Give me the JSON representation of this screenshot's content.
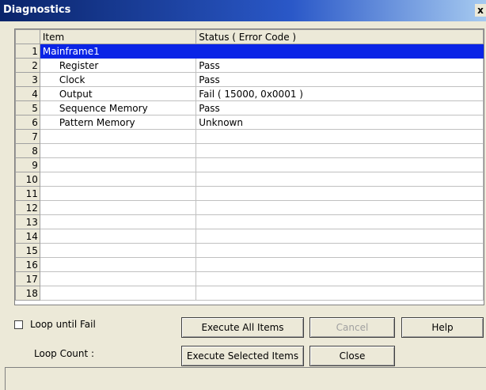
{
  "window": {
    "title": "Diagnostics",
    "close_glyph": "x"
  },
  "grid": {
    "headers": {
      "item": "Item",
      "status": "Status ( Error Code )"
    },
    "rows": [
      {
        "n": "1",
        "item": "Mainframe1",
        "status": "",
        "selected": true,
        "indent": false
      },
      {
        "n": "2",
        "item": "Register",
        "status": "Pass",
        "indent": true
      },
      {
        "n": "3",
        "item": "Clock",
        "status": "Pass",
        "indent": true
      },
      {
        "n": "4",
        "item": "Output",
        "status": "Fail ( 15000, 0x0001 )",
        "indent": true
      },
      {
        "n": "5",
        "item": "Sequence Memory",
        "status": "Pass",
        "indent": true
      },
      {
        "n": "6",
        "item": "Pattern Memory",
        "status": "Unknown",
        "indent": true
      },
      {
        "n": "7",
        "item": "",
        "status": ""
      },
      {
        "n": "8",
        "item": "",
        "status": ""
      },
      {
        "n": "9",
        "item": "",
        "status": ""
      },
      {
        "n": "10",
        "item": "",
        "status": ""
      },
      {
        "n": "11",
        "item": "",
        "status": ""
      },
      {
        "n": "12",
        "item": "",
        "status": ""
      },
      {
        "n": "13",
        "item": "",
        "status": ""
      },
      {
        "n": "14",
        "item": "",
        "status": ""
      },
      {
        "n": "15",
        "item": "",
        "status": ""
      },
      {
        "n": "16",
        "item": "",
        "status": ""
      },
      {
        "n": "17",
        "item": "",
        "status": ""
      },
      {
        "n": "18",
        "item": "",
        "status": ""
      }
    ]
  },
  "controls": {
    "loop_until_fail": "Loop until Fail",
    "loop_count": "Loop Count :",
    "execute_all": "Execute All Items",
    "cancel": "Cancel",
    "help": "Help",
    "execute_selected": "Execute Selected Items",
    "close": "Close"
  },
  "colors": {
    "selection": "#0a24e6",
    "title_bar": "#0a246a"
  }
}
